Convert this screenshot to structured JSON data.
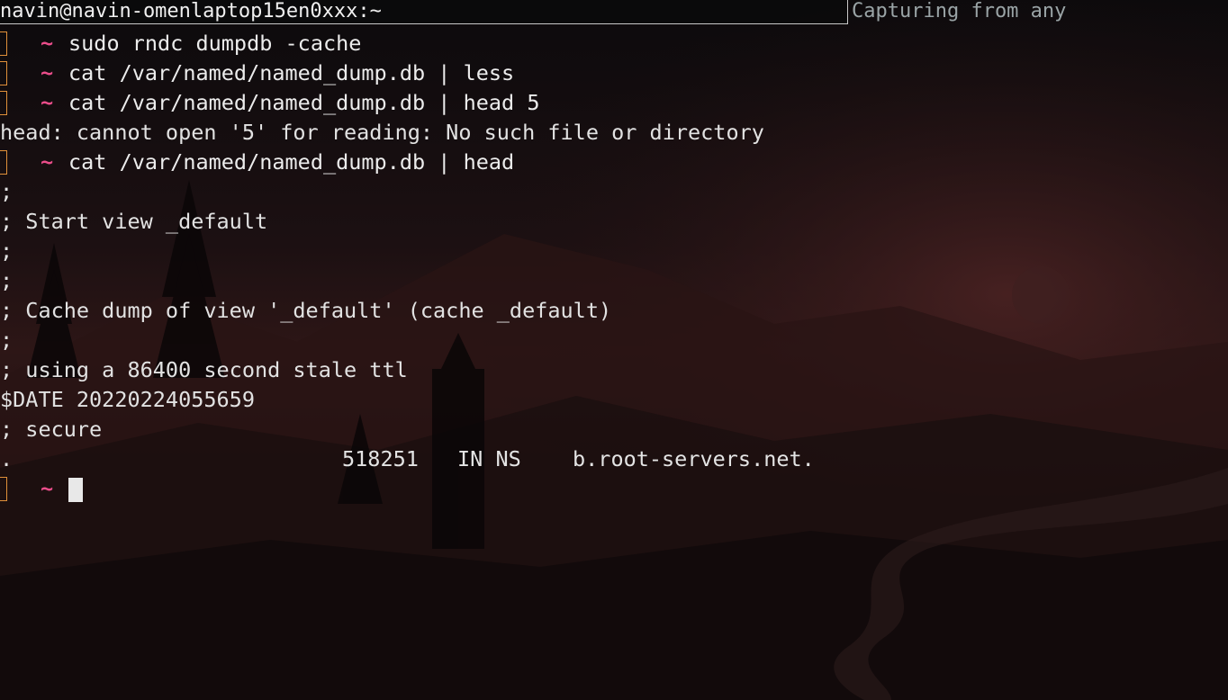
{
  "window": {
    "title": "navin@navin-omenlaptop15en0xxx:~",
    "status_text": "Capturing from any"
  },
  "terminal": {
    "prompt_symbol": "~",
    "lines": [
      {
        "type": "prompt",
        "command": "sudo rndc dumpdb -cache"
      },
      {
        "type": "prompt",
        "command": "cat /var/named/named_dump.db | less"
      },
      {
        "type": "prompt",
        "command": "cat /var/named/named_dump.db | head 5"
      },
      {
        "type": "output",
        "text": "head: cannot open '5' for reading: No such file or directory"
      },
      {
        "type": "prompt",
        "command": "cat /var/named/named_dump.db | head"
      },
      {
        "type": "output",
        "text": ";"
      },
      {
        "type": "output",
        "text": "; Start view _default"
      },
      {
        "type": "output",
        "text": ";"
      },
      {
        "type": "output",
        "text": ";"
      },
      {
        "type": "output",
        "text": "; Cache dump of view '_default' (cache _default)"
      },
      {
        "type": "output",
        "text": ";"
      },
      {
        "type": "output",
        "text": "; using a 86400 second stale ttl"
      },
      {
        "type": "output",
        "text": "$DATE 20220224055659"
      },
      {
        "type": "output",
        "text": "; secure"
      }
    ],
    "record": {
      "name": ".",
      "ttl": "518251",
      "class_type": "IN NS",
      "target": "b.root-servers.net."
    },
    "active_prompt": {
      "command": ""
    }
  },
  "colors": {
    "prompt_box": "#e0903a",
    "prompt_tilde": "#ea4d8a",
    "text": "#e4e4e4",
    "status_text": "#9aa4a6"
  },
  "icons": {
    "cursor": "block-cursor-icon",
    "prompt_indicator": "prompt-box-icon"
  }
}
